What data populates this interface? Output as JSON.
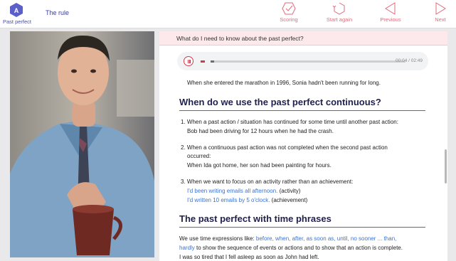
{
  "header": {
    "logo_letter": "A",
    "logo_label": "Past perfect",
    "title": "The rule",
    "nav": {
      "scoring": "Scoring",
      "start_again": "Start again",
      "previous": "Previous",
      "next": "Next"
    }
  },
  "question": "What do I need to know about the past perfect?",
  "player": {
    "time": "00:04 / 02:49",
    "progress": 0.02
  },
  "content": {
    "top_example": "When she entered the marathon in 1996, Sonia hadn't been running for long.",
    "section1_title": "When do we use the past perfect continuous?",
    "item1": "1. When a past action / situation has continued for some time until another past action:",
    "item1_example": "Bob had been driving for 12 hours when he had the crash.",
    "item2_line1": "2. When a continuous past action was not completed when the second past action",
    "item2_line2": "occurred:",
    "item2_example": "When Ida got home, her son had been painting for hours.",
    "item3": "3. When we want to focus on an activity rather than an achievement:",
    "item3_ex1": "I'd been writing emails all afternoon.",
    "item3_ex1_note": " (activity)",
    "item3_ex2": "I'd written 10 emails by 5 o'clock.",
    "item3_ex2_note": " (achievement)",
    "section2_title": "The past perfect with time phrases",
    "para_prefix": "We use time expressions like: ",
    "para_expressions": "before, when, after, as soon as, until, no sooner ... than,",
    "para_line2_highlight": "hardly",
    "para_line2_rest": " to show the sequence of events or actions and to show that an action is complete.",
    "para_example": "I was so tired that I fell asleep as soon as John had left."
  },
  "colors": {
    "accent": "#d23b4c",
    "nav_label": "#e26a7a",
    "example_blue": "#3a73d6",
    "heading": "#1f2050",
    "question_bg": "#fde9ec",
    "logo": "#5b5fc7"
  }
}
